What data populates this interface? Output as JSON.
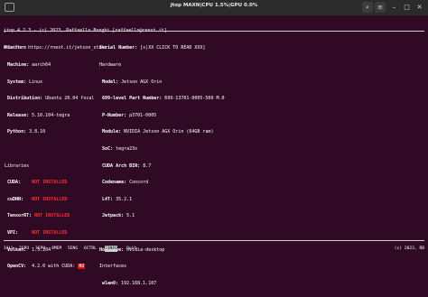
{
  "window": {
    "title": "jtop MAXN|CPU 1.5%|GPU 0.0%"
  },
  "header": {
    "line1": "jtop 4.2.3 - (c) 2023, Raffaello Bonghi [raffaello@rnext.it]",
    "line2": "Website: https://rnext.it/jetson_stats"
  },
  "platform": {
    "title": "Platform",
    "rows": [
      {
        "key": "Machine:",
        "value": "aarch64"
      },
      {
        "key": "System:",
        "value": "Linux"
      },
      {
        "key": "Distribution:",
        "value": "Ubuntu 20.04 focal"
      },
      {
        "key": "Release:",
        "value": "5.10.104-tegra"
      },
      {
        "key": "Python:",
        "value": "3.8.10"
      }
    ]
  },
  "libraries": {
    "title": "Libraries",
    "rows": [
      {
        "key": "CUDA:",
        "value": "NOT INSTALLED"
      },
      {
        "key": "cuDNN:",
        "value": "NOT INSTALLED"
      },
      {
        "key": "TensorRT:",
        "value": "NOT INSTALLED"
      },
      {
        "key": "VPI:",
        "value": "NOT INSTALLED"
      },
      {
        "key": "Vulkan:",
        "value": "1.3.204"
      }
    ],
    "opencv": {
      "key": "OpenCV:",
      "value": "4.2.0 with CUDA:",
      "cuda": "NO"
    }
  },
  "hardware": {
    "serial": {
      "key": "Serial Number:",
      "value": "[s|XX CLICK TO READ XXX]"
    },
    "title": "Hardware",
    "rows": [
      {
        "key": "Model:",
        "value": "Jetson AGX Orin"
      },
      {
        "key": "699-level Part Number:",
        "value": "699-13701-0005-500 M.0"
      },
      {
        "key": "P-Number:",
        "value": "p3701-0005"
      },
      {
        "key": "Module:",
        "value": "NVIDIA Jetson AGX Orin (64GB ram)"
      },
      {
        "key": "SoC:",
        "value": "tegra23x"
      },
      {
        "key": "CUDA Arch BIN:",
        "value": "8.7"
      },
      {
        "key": "Codename:",
        "value": "Concord"
      },
      {
        "key": "L4T:",
        "value": "35.2.1"
      },
      {
        "key": "Jetpack:",
        "value": "5.1"
      }
    ]
  },
  "network": {
    "hostname": {
      "key": "Hostname:",
      "value": "nvidia-desktop"
    },
    "title": "Interfaces",
    "rows": [
      {
        "key": "wlan0:",
        "value": "192.168.1.107"
      }
    ]
  },
  "bottom_bar": {
    "tabs": [
      {
        "num": "1",
        "label": "ALL"
      },
      {
        "num": "2",
        "label": "GPU"
      },
      {
        "num": "3",
        "label": "CPU"
      },
      {
        "num": "4",
        "label": "MEM"
      },
      {
        "num": "5",
        "label": "ENG"
      },
      {
        "num": "6",
        "label": "CTRL"
      },
      {
        "num": "7",
        "label": "INFO"
      },
      {
        "num": "Q",
        "label": "uit"
      }
    ],
    "active_tab": "INFO",
    "copyright": "(c) 2023, RB"
  }
}
